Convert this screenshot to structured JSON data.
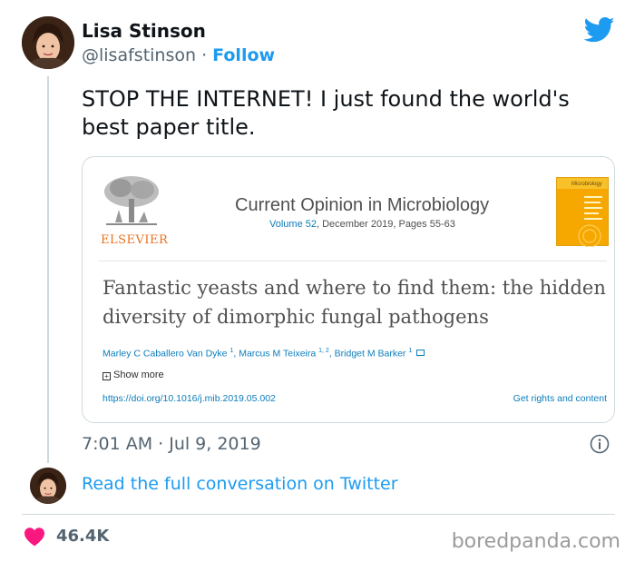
{
  "author": {
    "name": "Lisa Stinson",
    "handle": "@lisafstinson",
    "separator": "·",
    "follow_label": "Follow"
  },
  "tweet": {
    "text": "STOP THE INTERNET! I just found the world's best paper title.",
    "timestamp": "7:01 AM · Jul 9, 2019"
  },
  "paper_card": {
    "publisher_word": "ELSEVIER",
    "journal_name": "Current Opinion in Microbiology",
    "volume_link": "Volume 52",
    "volume_rest": ", December 2019, Pages 55-63",
    "cover_title": "Microbiology",
    "title": "Fantastic yeasts and where to find them: the hidden diversity of dimorphic fungal pathogens",
    "authors": [
      {
        "name": "Marley C Caballero Van Dyke",
        "sup": "1"
      },
      {
        "name": "Marcus M Teixeira",
        "sup": "1, 2"
      },
      {
        "name": "Bridget M Barker",
        "sup": "1"
      }
    ],
    "show_more_label": "Show more",
    "doi": "https://doi.org/10.1016/j.mib.2019.05.002",
    "rights_label": "Get rights and content"
  },
  "read_conversation_label": "Read the full conversation on Twitter",
  "likes": "46.4K",
  "watermark": "boredpanda.com",
  "colors": {
    "twitter_blue": "#1d9bf0",
    "heart_red": "#f91880",
    "elsevier_orange": "#e9711c",
    "link_blue": "#0c7dbb"
  },
  "icons": [
    "twitter-bird-icon",
    "info-icon",
    "heart-icon",
    "mail-icon",
    "plus-box-icon"
  ]
}
